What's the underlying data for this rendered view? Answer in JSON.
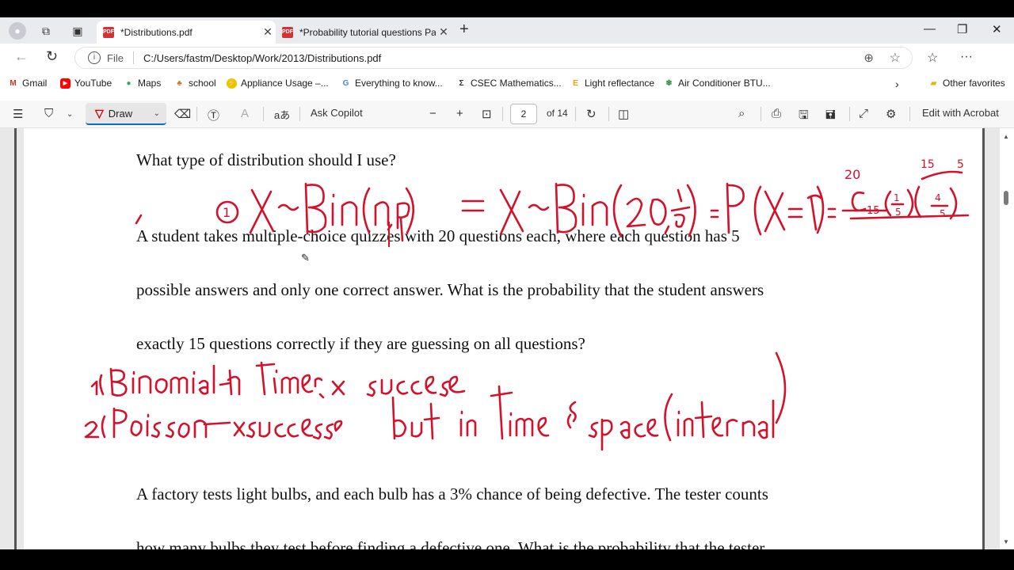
{
  "tabs": [
    {
      "label": "*Distributions.pdf",
      "active": true
    },
    {
      "label": "*Probability tutorial questions Par",
      "active": false
    }
  ],
  "address": {
    "scheme_label": "File",
    "url": "C:/Users/fastm/Desktop/Work/2013/Distributions.pdf"
  },
  "favorites": [
    {
      "label": "Gmail",
      "icon": "gmail-icon"
    },
    {
      "label": "YouTube",
      "icon": "youtube-icon"
    },
    {
      "label": "Maps",
      "icon": "maps-pin-icon"
    },
    {
      "label": "school",
      "icon": "school-icon"
    },
    {
      "label": "Appliance Usage –...",
      "icon": "appliance-icon"
    },
    {
      "label": "Everything to know...",
      "icon": "google-icon"
    },
    {
      "label": "CSEC Mathematics...",
      "icon": "sigma-icon"
    },
    {
      "label": "Light reflectance",
      "icon": "e-icon"
    },
    {
      "label": "Air Conditioner BTU...",
      "icon": "ac-icon"
    }
  ],
  "other_favorites": "Other favorites",
  "pdf_toolbar": {
    "draw_label": "Draw",
    "read_aloud_glyph": "aあ",
    "ask_copilot": "Ask Copilot",
    "page_current": "2",
    "page_total": "of 14",
    "edit_acrobat": "Edit with Acrobat"
  },
  "document": {
    "lines": [
      "What type of distribution should I use?",
      "A student takes multiple-choice quizzes with 20 questions each, where each question has 5",
      "possible answers and only one correct answer. What is the probability that the student answers",
      "exactly 15 questions correctly if they are guessing on all questions?",
      "A factory tests light bulbs, and each bulb has a 3% chance of being defective. The tester counts",
      "how many bulbs they test before finding a defective one. What is the probability that the tester"
    ]
  },
  "annotations": {
    "line1": "① X~Bin(n,p)  = X~Bin(20, 1/5) = P(X=15) = 20C15(1/5)^15 (4/5)^5",
    "line2": "1) Binomial - n times, x successes",
    "line3": "2) Poisson - x successes  but in time & space (interval)"
  },
  "colors": {
    "ink": "#d4102a",
    "accent": "#0f6cbd"
  }
}
